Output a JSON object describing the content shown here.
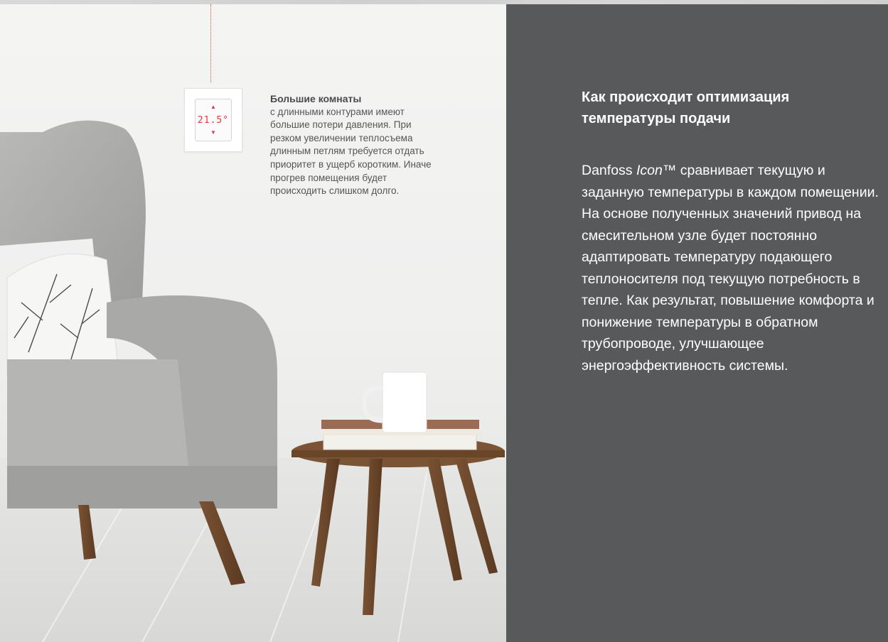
{
  "callout": {
    "title": "Большие комнаты",
    "body": "с длинными контурами имеют большие потери давления. При резком увеличении теплосъема длинным петлям требуется отдать приоритет в ущерб коротким. Иначе прогрев помещения будет происходить слишком долго."
  },
  "thermostat": {
    "readout": "21.5°"
  },
  "panel": {
    "heading": "Как происходит оптимизация температуры подачи",
    "body_brand": "Danfoss ",
    "body_product": "Icon",
    "body_text": "™ сравнивает текущую и заданную температуры в каждом помещении. На основе полученных значений привод на смесительном узле будет постоянно адаптировать температуру подающего теплоносителя под текущую потребность в тепле. Как результат, повышение комфорта и понижение температуры в обратном трубопроводе, улучшающее энергоэффективность системы."
  },
  "colors": {
    "panel_bg": "#58595b",
    "accent_red": "#e03a3a"
  }
}
